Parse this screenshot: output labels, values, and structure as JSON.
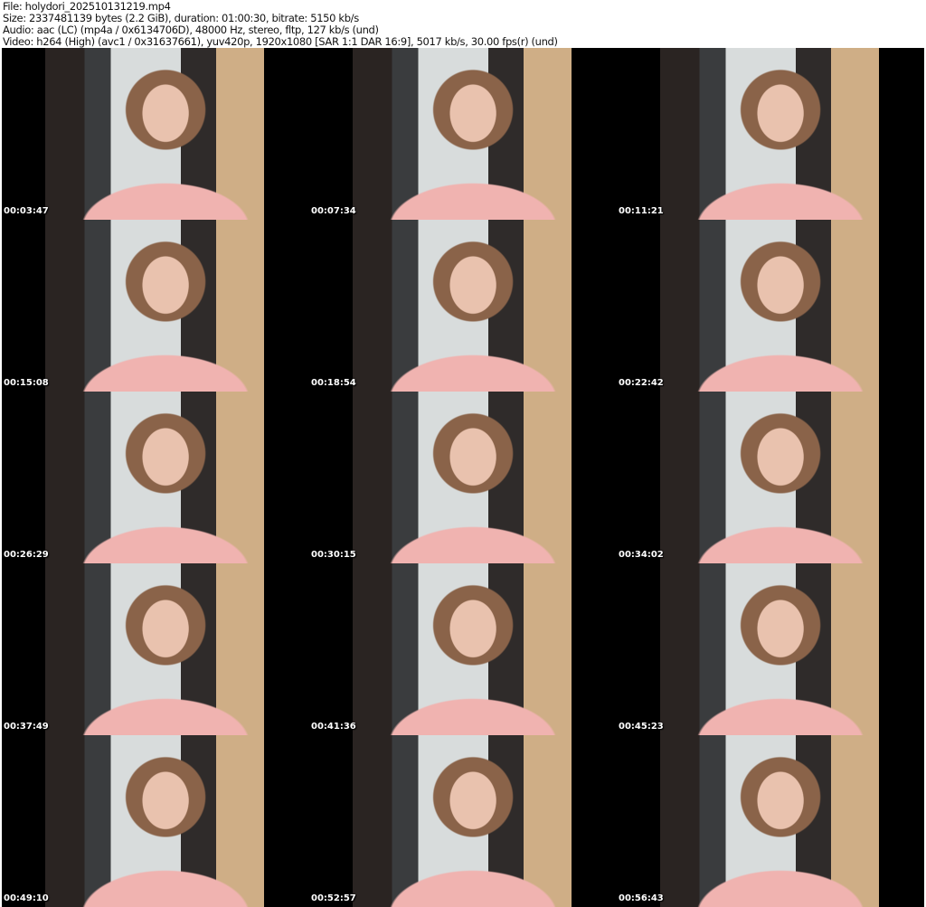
{
  "header": {
    "file": "File: holydori_202510131219.mp4",
    "size": "Size: 2337481139 bytes (2.2 GiB), duration: 01:00:30, bitrate: 5150 kb/s",
    "audio": "Audio: aac (LC) (mp4a / 0x6134706D), 48000 Hz, stereo, fltp, 127 kb/s (und)",
    "video": "Video: h264 (High) (avc1 / 0x31637661), yuv420p, 1920x1080 [SAR 1:1 DAR 16:9], 5017 kb/s, 30.00 fps(r) (und)"
  },
  "thumbnails": [
    {
      "time": "00:03:47"
    },
    {
      "time": "00:07:34"
    },
    {
      "time": "00:11:21"
    },
    {
      "time": "00:15:08"
    },
    {
      "time": "00:18:54"
    },
    {
      "time": "00:22:42"
    },
    {
      "time": "00:26:29"
    },
    {
      "time": "00:30:15"
    },
    {
      "time": "00:34:02"
    },
    {
      "time": "00:37:49"
    },
    {
      "time": "00:41:36"
    },
    {
      "time": "00:45:23"
    },
    {
      "time": "00:49:10"
    },
    {
      "time": "00:52:57"
    },
    {
      "time": "00:56:43"
    }
  ]
}
